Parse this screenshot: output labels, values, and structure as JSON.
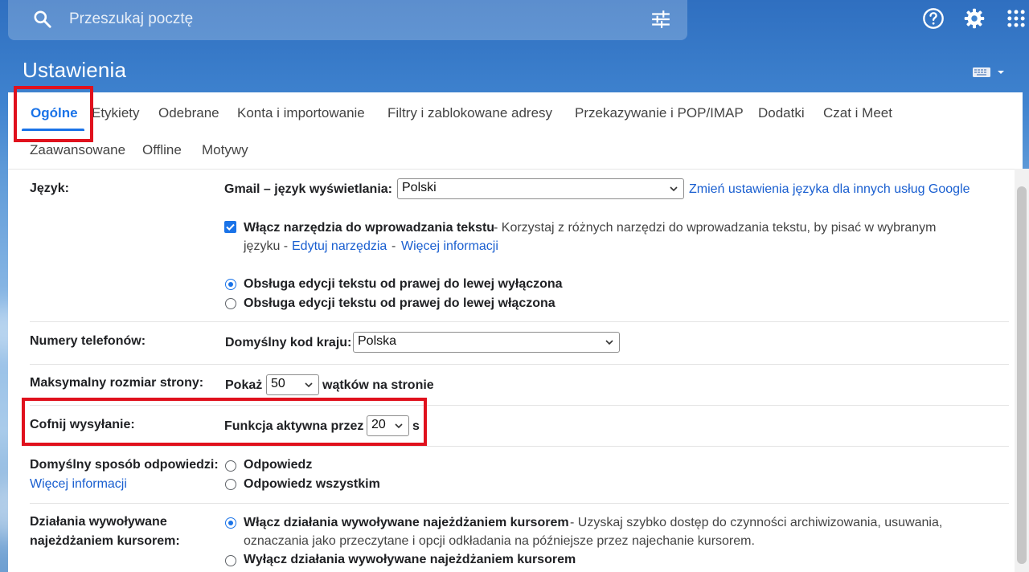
{
  "search": {
    "placeholder": "Przeszukaj pocztę"
  },
  "page": {
    "title": "Ustawienia"
  },
  "tabs": {
    "row1": [
      "Ogólne",
      "Etykiety",
      "Odebrane",
      "Konta i importowanie",
      "Filtry i zablokowane adresy",
      "Przekazywanie i POP/IMAP",
      "Dodatki",
      "Czat i Meet"
    ],
    "row2": [
      "Zaawansowane",
      "Offline",
      "Motywy"
    ],
    "active": "Ogólne"
  },
  "settings": {
    "language": {
      "label": "Język:",
      "display_label": "Gmail – język wyświetlania:",
      "display_value": "Polski",
      "change_link": "Zmień ustawienia języka dla innych usług Google",
      "input_tools_bold": "Włącz narzędzia do wprowadzania tekstu",
      "input_tools_desc_line1": " - Korzystaj z różnych narzędzi do wprowadzania tekstu, by pisać w wybranym",
      "input_tools_desc_line2": "języku - ",
      "edit_tools_link": "Edytuj narzędzia",
      "sep": " - ",
      "more_info_link": "Więcej informacji",
      "rtl_off": "Obsługa edycji tekstu od prawej do lewej wyłączona",
      "rtl_on": "Obsługa edycji tekstu od prawej do lewej włączona",
      "input_tools_checked": true,
      "rtl_selected": "off"
    },
    "phone": {
      "label": "Numery telefonów:",
      "default_code_label": "Domyślny kod kraju:",
      "default_code_value": "Polska"
    },
    "page_size": {
      "label": "Maksymalny rozmiar strony:",
      "show_label": "Pokaż",
      "value": "50",
      "suffix": "wątków na stronie"
    },
    "undo_send": {
      "label": "Cofnij wysyłanie:",
      "active_label": "Funkcja aktywna przez",
      "value": "20",
      "unit": "s"
    },
    "reply": {
      "label": "Domyślny sposób odpowiedzi:",
      "more_info_link": "Więcej informacji",
      "option_reply": "Odpowiedz",
      "option_reply_all": "Odpowiedz wszystkim",
      "selected": "reply"
    },
    "hover": {
      "label_line1": "Działania wywoływane",
      "label_line2": "najeżdżaniem kursorem:",
      "enable_bold": "Włącz działania wywoływane najeżdżaniem kursorem",
      "enable_desc_line1": " - Uzyskaj szybko dostęp do czynności archiwizowania, usuwania,",
      "enable_desc_line2": "oznaczania jako przeczytane i opcji odkładania na późniejsze przez najechanie kursorem.",
      "disable_bold": "Wyłącz działania wywoływane najeżdżaniem kursorem",
      "selected": "enable"
    }
  },
  "colors": {
    "accent": "#1a73e8",
    "link": "#1a5fd0",
    "highlight": "#e0111d"
  },
  "icons": [
    "search-icon",
    "tune-icon",
    "help-icon",
    "gear-icon",
    "apps-icon",
    "keyboard-icon",
    "chevron-down-icon",
    "check-icon"
  ]
}
